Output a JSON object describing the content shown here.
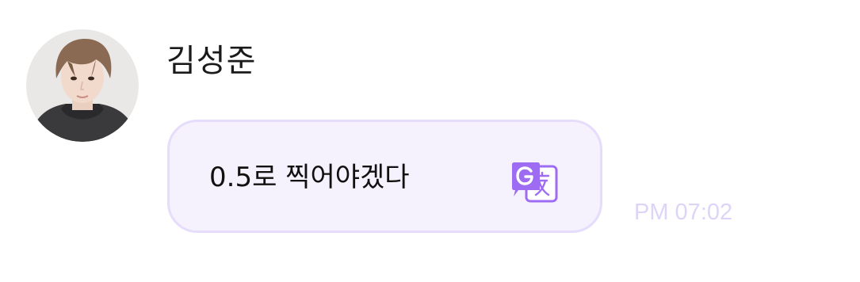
{
  "message": {
    "sender_name": "김성준",
    "text": "0.5로 찍어야겠다",
    "timestamp": "PM 07:02"
  },
  "colors": {
    "bubble_background": "#f5f2fd",
    "bubble_border": "#e6dcfb",
    "translate_icon": "#9e6cf2",
    "timestamp": "#ddd4f7"
  },
  "icons": {
    "avatar": "profile-photo",
    "translate": "translate-icon"
  }
}
